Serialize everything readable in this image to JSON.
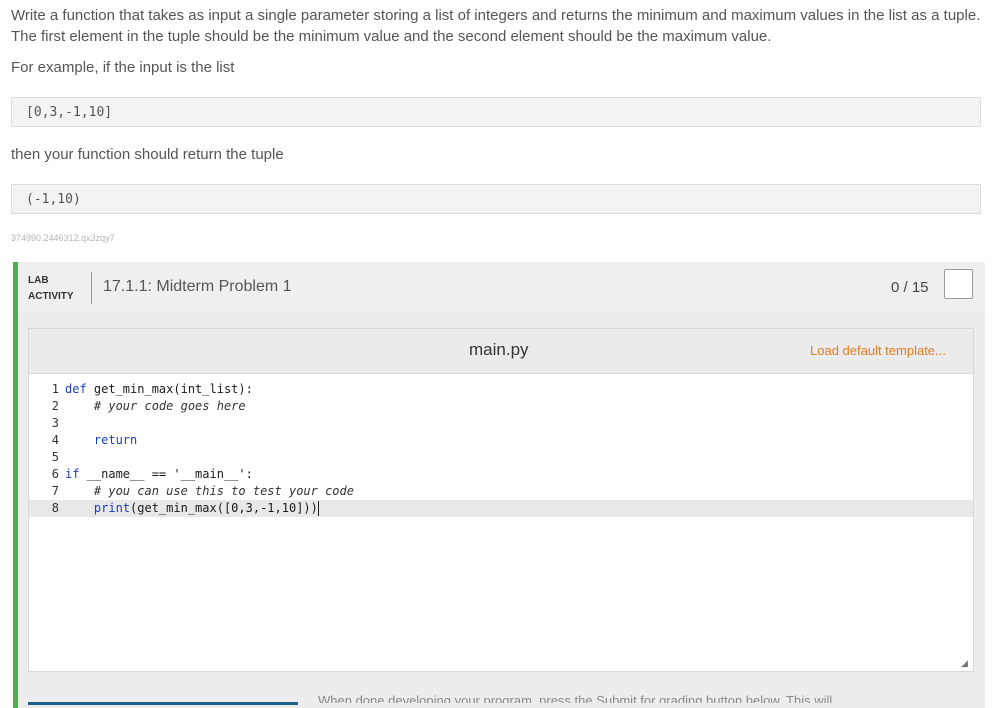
{
  "problem": {
    "intro": "Write a function that takes as input a single parameter storing a list of integers and returns the minimum and maximum values in the list as a tuple. The first element in the tuple should be the minimum value and the second element should be the maximum value.",
    "example_lead": "For example, if the input is the list",
    "example_input": "[0,3,-1,10]",
    "result_lead": "then your function should return the tuple",
    "example_output": "(-1,10)",
    "hash": "374990.2446312.qx3zqy7"
  },
  "lab": {
    "label_line1": "LAB",
    "label_line2": "ACTIVITY",
    "title": "17.1.1: Midterm Problem 1",
    "score": "0 / 15",
    "accent_color": "#4caf50"
  },
  "editor": {
    "file_name": "main.py",
    "load_template_label": "Load default template...",
    "lines": [
      {
        "num": "1",
        "text": "def get_min_max(int_list):"
      },
      {
        "num": "2",
        "text": "    # your code goes here"
      },
      {
        "num": "3",
        "text": ""
      },
      {
        "num": "4",
        "text": "    return"
      },
      {
        "num": "5",
        "text": ""
      },
      {
        "num": "6",
        "text": "if __name__ == '__main__':"
      },
      {
        "num": "7",
        "text": "    # you can use this to test your code"
      },
      {
        "num": "8",
        "text": "    print(get_min_max([0,3,-1,10]))"
      }
    ],
    "active_line": 8
  },
  "footer": {
    "partial_text": "When done developing your program, press the Submit for grading button below. This will"
  },
  "icons": {
    "score_box": "checkbox-square-icon",
    "resize": "resize-handle-icon"
  }
}
